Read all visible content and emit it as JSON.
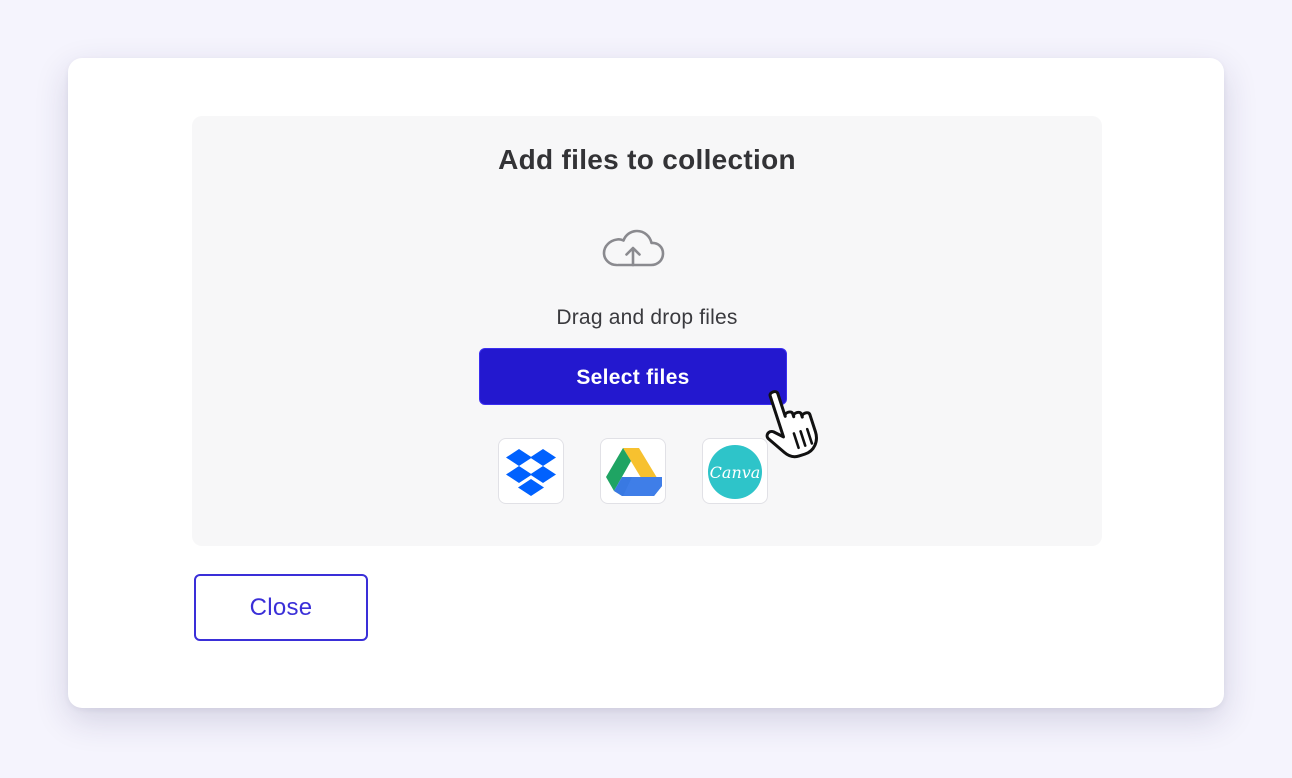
{
  "modal": {
    "title": "Add files to collection",
    "upload_icon": "cloud-upload-icon",
    "hint": "Drag and drop files",
    "select_button_label": "Select files",
    "close_button_label": "Close",
    "cursor_icon": "hand-pointer-icon"
  },
  "integrations": [
    {
      "name": "Dropbox",
      "icon": "dropbox-icon"
    },
    {
      "name": "Google Drive",
      "icon": "google-drive-icon"
    },
    {
      "name": "Canva",
      "icon": "canva-icon",
      "text": "Canva"
    }
  ],
  "colors": {
    "page_background": "#f5f4fd",
    "modal_background": "#ffffff",
    "dropzone_background": "#f7f7f8",
    "primary": "#2318cf",
    "outline_accent": "#3a2fd8",
    "dropbox_blue": "#0061fe",
    "canva_teal": "#2ec4c9"
  }
}
